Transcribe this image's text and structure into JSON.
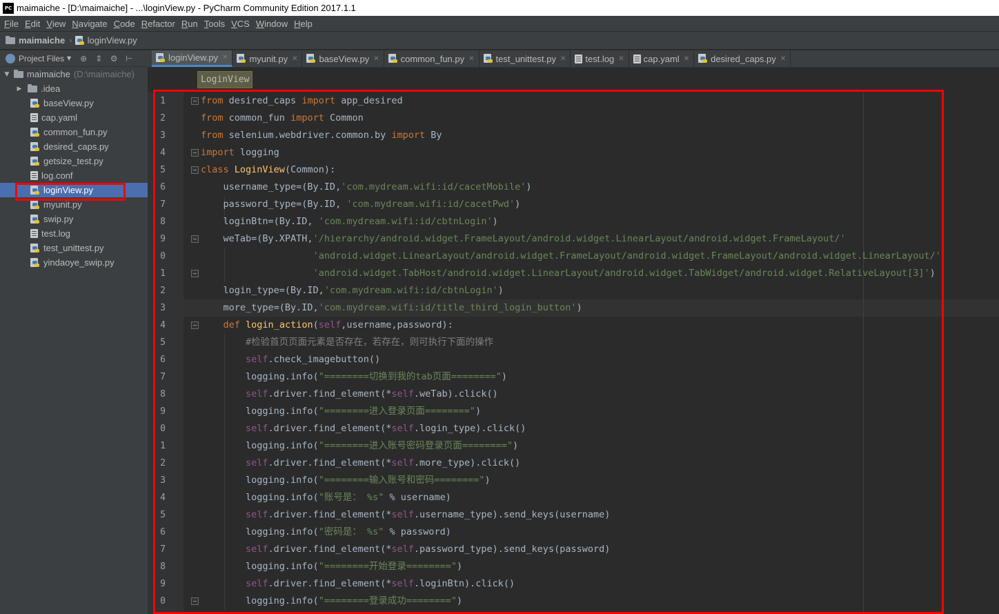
{
  "window": {
    "app_icon": "PC",
    "title": "maimaiche - [D:\\maimaiche] - ...\\loginView.py - PyCharm Community Edition 2017.1.1"
  },
  "menu": [
    "File",
    "Edit",
    "View",
    "Navigate",
    "Code",
    "Refactor",
    "Run",
    "Tools",
    "VCS",
    "Window",
    "Help"
  ],
  "navbar": {
    "project": "maimaiche",
    "file": "loginView.py"
  },
  "project_panel": {
    "label": "Project Files",
    "root": {
      "name": "maimaiche",
      "path": "(D:\\maimaiche)"
    },
    "items": [
      {
        "name": ".idea",
        "type": "folder"
      },
      {
        "name": "baseView.py",
        "type": "py"
      },
      {
        "name": "cap.yaml",
        "type": "txt"
      },
      {
        "name": "common_fun.py",
        "type": "py"
      },
      {
        "name": "desired_caps.py",
        "type": "py"
      },
      {
        "name": "getsize_test.py",
        "type": "py"
      },
      {
        "name": "log.conf",
        "type": "txt"
      },
      {
        "name": "loginView.py",
        "type": "py",
        "selected": true
      },
      {
        "name": "myunit.py",
        "type": "py"
      },
      {
        "name": "swip.py",
        "type": "py"
      },
      {
        "name": "test.log",
        "type": "txt"
      },
      {
        "name": "test_unittest.py",
        "type": "py"
      },
      {
        "name": "yindaoye_swip.py",
        "type": "py"
      }
    ]
  },
  "tabs": [
    {
      "name": "loginView.py",
      "type": "py",
      "active": true
    },
    {
      "name": "myunit.py",
      "type": "py"
    },
    {
      "name": "baseView.py",
      "type": "py"
    },
    {
      "name": "common_fun.py",
      "type": "py"
    },
    {
      "name": "test_unittest.py",
      "type": "py"
    },
    {
      "name": "test.log",
      "type": "txt"
    },
    {
      "name": "cap.yaml",
      "type": "txt"
    },
    {
      "name": "desired_caps.py",
      "type": "py"
    }
  ],
  "editor": {
    "breadcrumb": "LoginView",
    "line_numbers": [
      "1",
      "2",
      "3",
      "4",
      "5",
      "6",
      "7",
      "8",
      "9",
      "0",
      "1",
      "2",
      "3",
      "4",
      "5",
      "6",
      "7",
      "8",
      "9",
      "0",
      "1",
      "2",
      "3",
      "4",
      "5",
      "6",
      "7",
      "8",
      "9",
      "0"
    ],
    "code": [
      "from desired_caps import app_desired",
      "from common_fun import Common",
      "from selenium.webdriver.common.by import By",
      "import logging",
      "class LoginView(Common):",
      "    username_type=(By.ID,'com.mydream.wifi:id/cacetMobile')",
      "    password_type=(By.ID, 'com.mydream.wifi:id/cacetPwd')",
      "    loginBtn=(By.ID, 'com.mydream.wifi:id/cbtnLogin')",
      "    weTab=(By.XPATH,'/hierarchy/android.widget.FrameLayout/android.widget.LinearLayout/android.widget.FrameLayout/'",
      "                    'android.widget.LinearLayout/android.widget.FrameLayout/android.widget.FrameLayout/android.widget.LinearLayout/'",
      "                    'android.widget.TabHost/android.widget.LinearLayout/android.widget.TabWidget/android.widget.RelativeLayout[3]')",
      "    login_type=(By.ID,'com.mydream.wifi:id/cbtnLogin')",
      "    more_type=(By.ID,'com.mydream.wifi:id/title_third_login_button')",
      "    def login_action(self,username,password):",
      "        #检验首页页面元素是否存在，若存在，则可执行下面的操作",
      "        self.check_imagebutton()",
      "        logging.info(\"========切换到我的tab页面========\")",
      "        self.driver.find_element(*self.weTab).click()",
      "        logging.info(\"========进入登录页面========\")",
      "        self.driver.find_element(*self.login_type).click()",
      "        logging.info(\"========进入账号密码登录页面========\")",
      "        self.driver.find_element(*self.more_type).click()",
      "        logging.info(\"========输入账号和密码========\")",
      "        logging.info(\"账号是： %s\" % username)",
      "        self.driver.find_element(*self.username_type).send_keys(username)",
      "        logging.info(\"密码是： %s\" % password)",
      "        self.driver.find_element(*self.password_type).send_keys(password)",
      "        logging.info(\"========开始登录========\")",
      "        self.driver.find_element(*self.loginBtn).click()",
      "        logging.info(\"========登录成功========\")"
    ]
  },
  "colors": {
    "highlight_box": "#ff0000",
    "keyword": "#cc7832",
    "string": "#6a8759",
    "self": "#94558d",
    "function": "#ffc66d",
    "comment": "#808080"
  }
}
